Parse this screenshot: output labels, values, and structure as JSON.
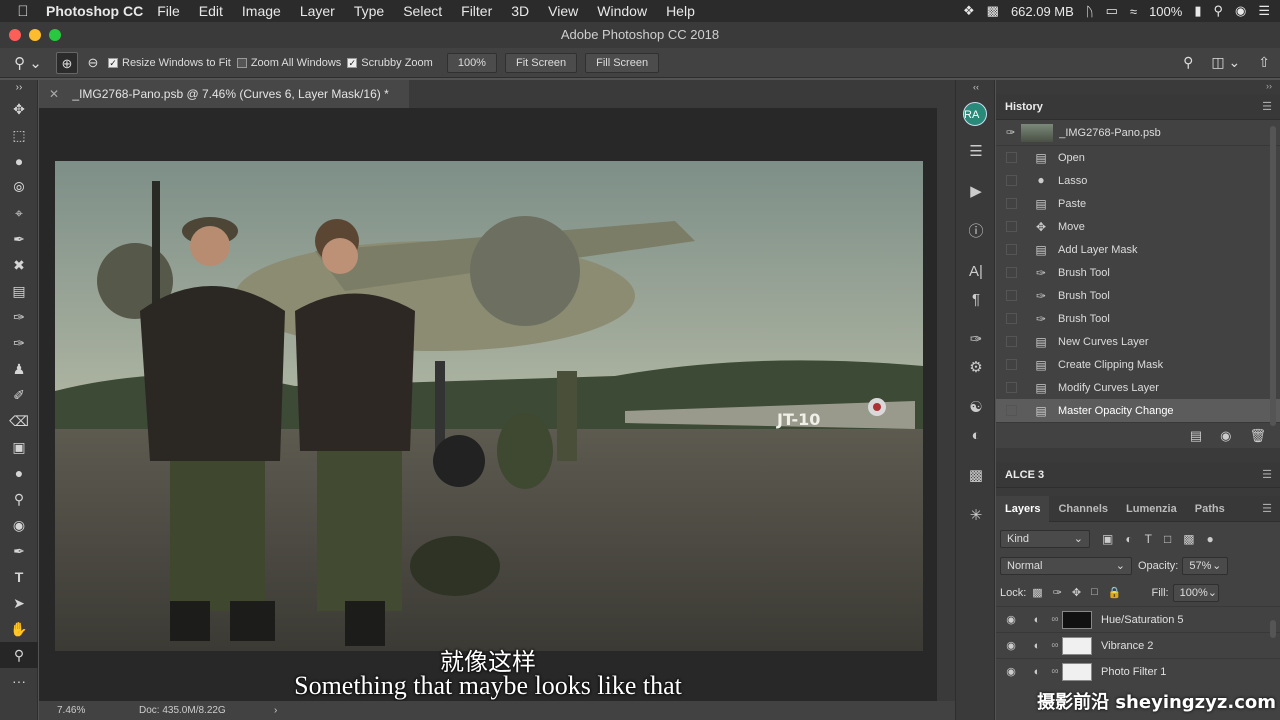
{
  "menubar": {
    "app_name": "Photoshop CC",
    "items": [
      "File",
      "Edit",
      "Image",
      "Layer",
      "Type",
      "Select",
      "Filter",
      "3D",
      "View",
      "Window",
      "Help"
    ],
    "memory": "662.09 MB",
    "battery": "100%"
  },
  "window": {
    "title": "Adobe Photoshop CC 2018"
  },
  "options": {
    "resize_windows": "Resize Windows to Fit",
    "zoom_all": "Zoom All Windows",
    "scrubby": "Scrubby Zoom",
    "zoom_value": "100%",
    "fit_screen": "Fit Screen",
    "fill_screen": "Fill Screen"
  },
  "document": {
    "tab_title": "_IMG2768-Pano.psb @ 7.46% (Curves 6, Layer Mask/16) *",
    "zoom": "7.46%",
    "doc_size": "Doc: 435.0M/8.22G",
    "image_marking": "JT-10"
  },
  "subtitles": {
    "zh": "就像这样",
    "en": "Something that maybe looks like that"
  },
  "history": {
    "title": "History",
    "snapshot": "_IMG2768-Pano.psb",
    "items": [
      {
        "label": "Open",
        "icon": "document-icon"
      },
      {
        "label": "Lasso",
        "icon": "lasso-icon"
      },
      {
        "label": "Paste",
        "icon": "document-icon"
      },
      {
        "label": "Move",
        "icon": "move-icon"
      },
      {
        "label": "Add Layer Mask",
        "icon": "document-icon"
      },
      {
        "label": "Brush Tool",
        "icon": "brush-icon"
      },
      {
        "label": "Brush Tool",
        "icon": "brush-icon"
      },
      {
        "label": "Brush Tool",
        "icon": "brush-icon"
      },
      {
        "label": "New Curves Layer",
        "icon": "document-icon"
      },
      {
        "label": "Create Clipping Mask",
        "icon": "document-icon"
      },
      {
        "label": "Modify Curves Layer",
        "icon": "document-icon"
      },
      {
        "label": "Master Opacity Change",
        "icon": "document-icon"
      }
    ]
  },
  "alce": {
    "title": "ALCE 3"
  },
  "layers_panel": {
    "tabs": [
      "Layers",
      "Channels",
      "Lumenzia",
      "Paths"
    ],
    "kind": "Kind",
    "blend_mode": "Normal",
    "opacity_label": "Opacity:",
    "opacity": "57%",
    "lock_label": "Lock:",
    "fill_label": "Fill:",
    "fill": "100%",
    "layers": [
      {
        "name": "Hue/Saturation 5",
        "mask": "dark"
      },
      {
        "name": "Vibrance 2",
        "mask": "light"
      },
      {
        "name": "Photo Filter 1",
        "mask": "light"
      }
    ]
  },
  "avatar": "RA",
  "watermark": "摄影前沿 sheyingzyz.com"
}
